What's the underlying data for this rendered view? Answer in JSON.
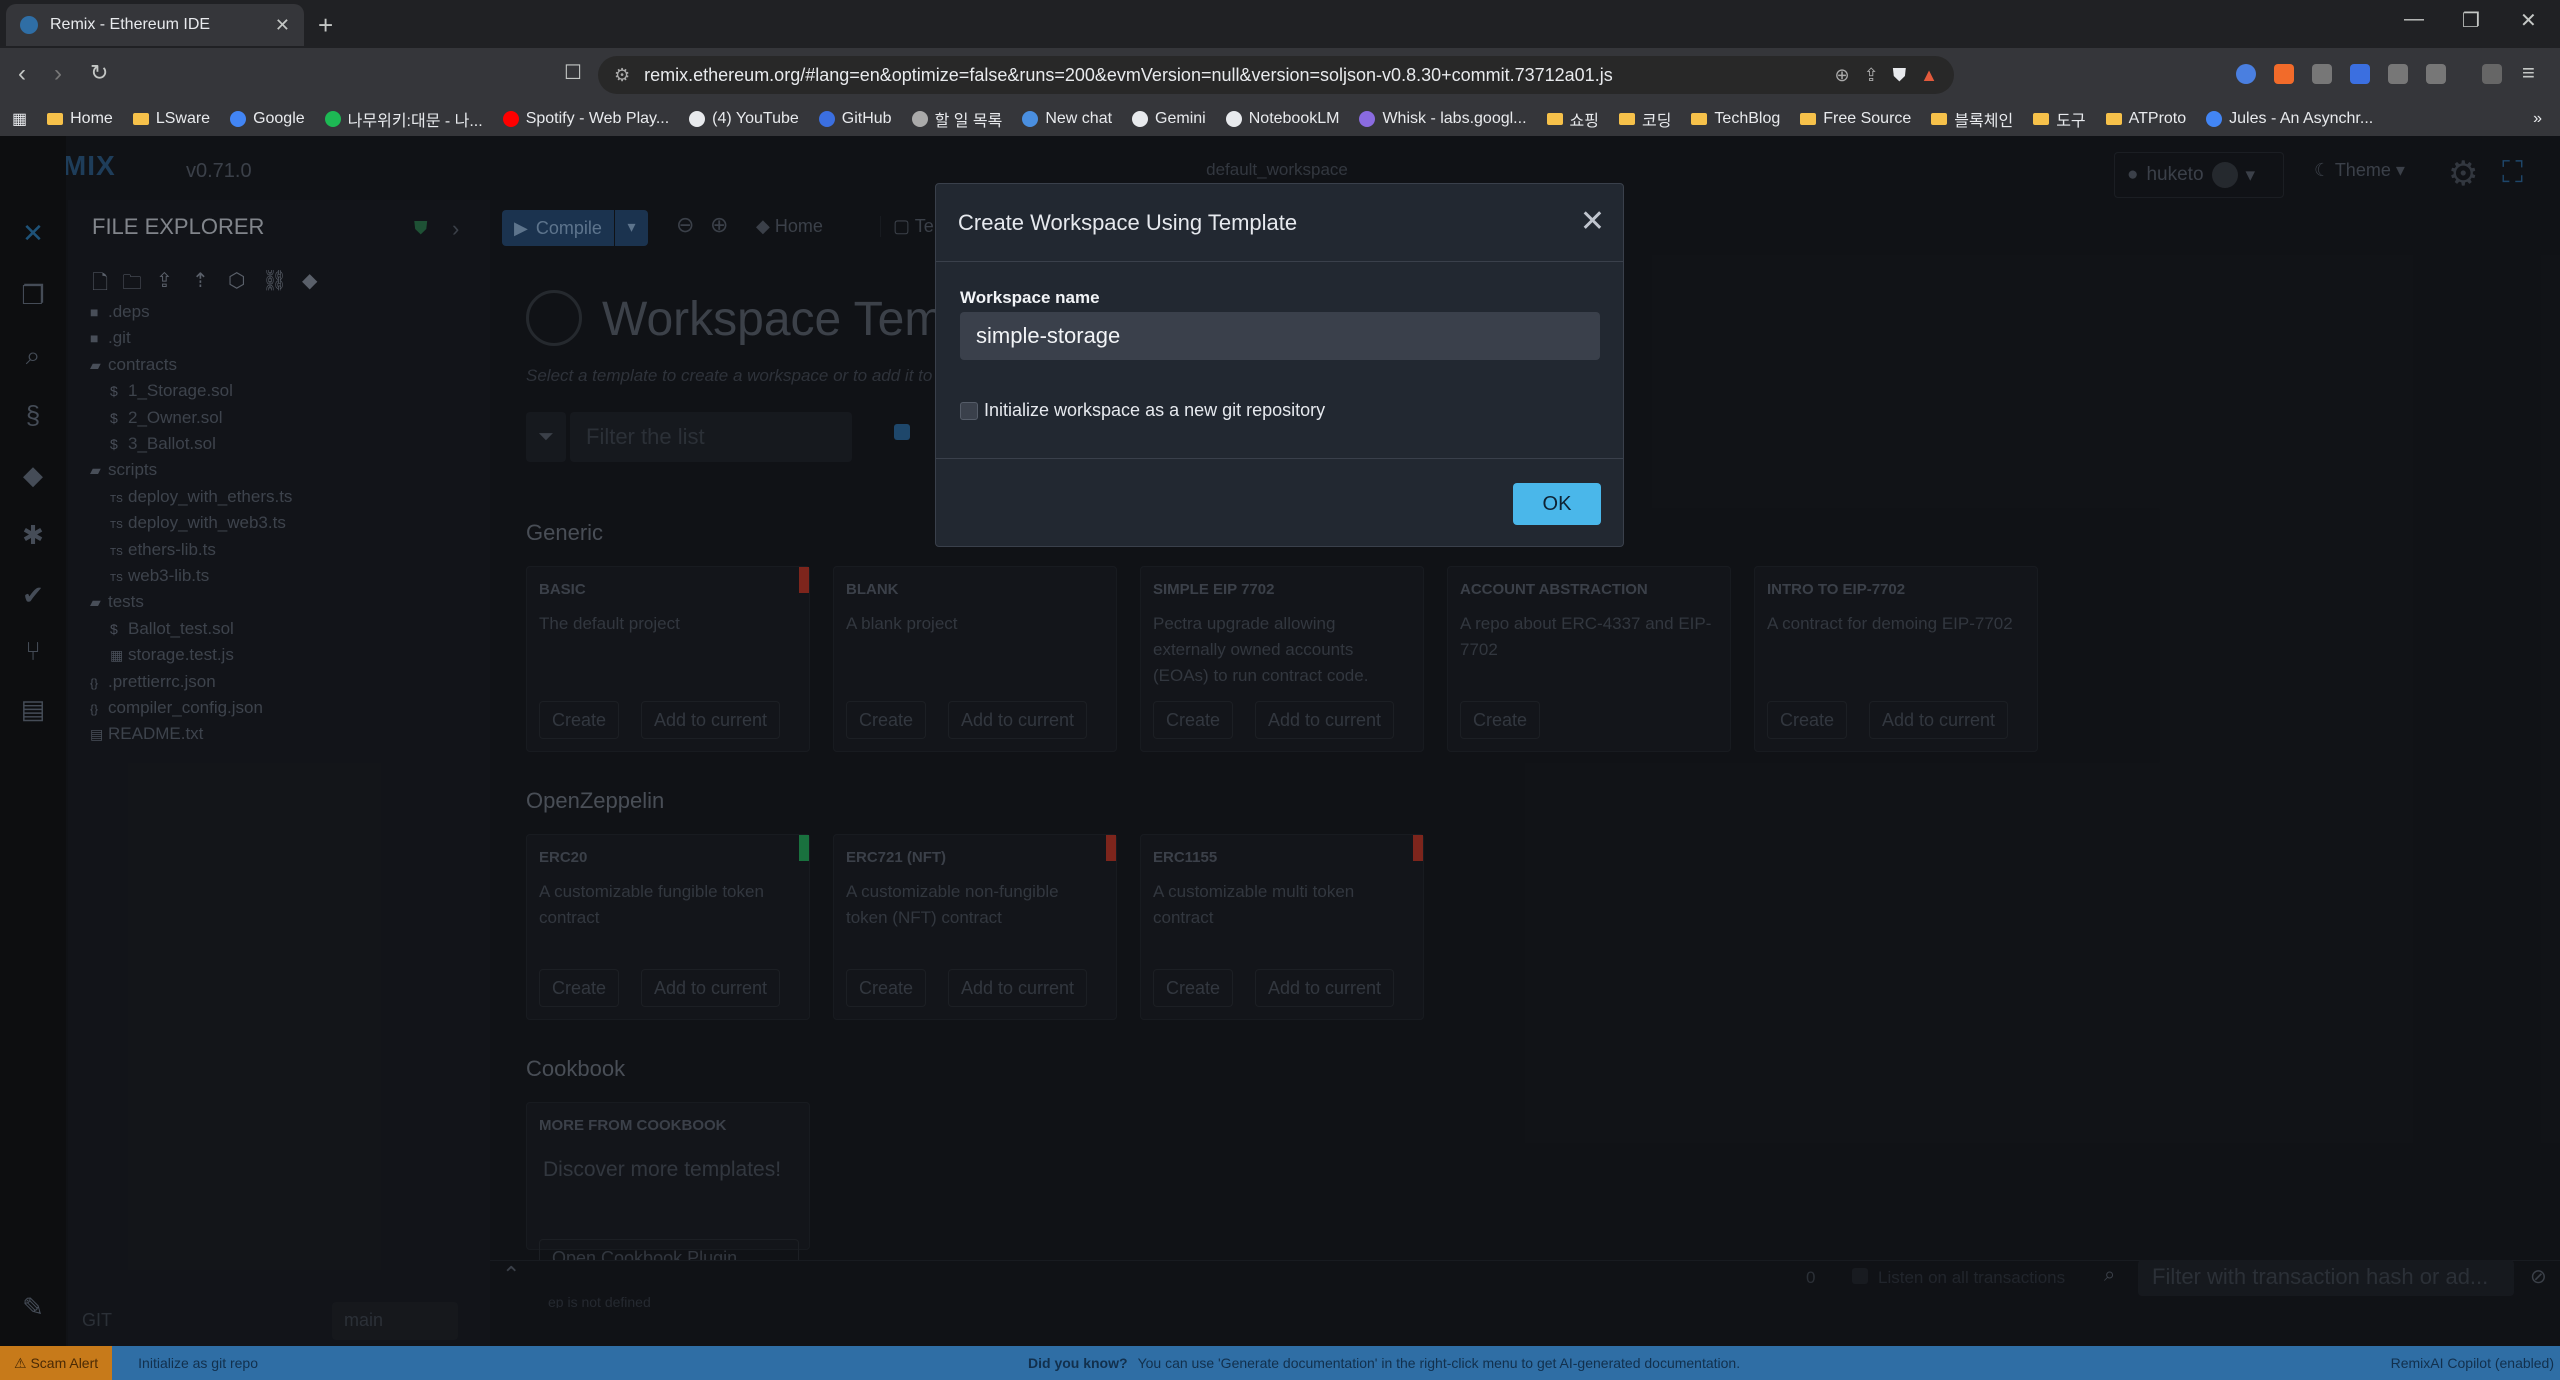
{
  "browser": {
    "tab_title": "Remix - Ethereum IDE",
    "url": "remix.ethereum.org/#lang=en&optimize=false&runs=200&evmVersion=null&version=soljson-v0.8.30+commit.73712a01.js",
    "bookmarks": [
      "Home",
      "LSware",
      "Google",
      "나무위키:대문 - 나...",
      "Spotify - Web Play...",
      "(4) YouTube",
      "GitHub",
      "할 일 목록",
      "New chat",
      "Gemini",
      "NotebookLM",
      "Whisk - labs.googl...",
      "쇼핑",
      "코딩",
      "TechBlog",
      "Free Source",
      "블록체인",
      "도구",
      "ATProto",
      "Jules - An Asynchr..."
    ]
  },
  "remix": {
    "logo": "REMIX",
    "version": "v0.71.0",
    "workspace": "default_workspace",
    "user": "huketo",
    "theme_label": "Theme",
    "file_explorer_title": "FILE EXPLORER",
    "files": [
      {
        "name": ".deps",
        "type": "folder",
        "indent": 0
      },
      {
        "name": ".git",
        "type": "folder",
        "indent": 0
      },
      {
        "name": "contracts",
        "type": "folder-open",
        "indent": 0
      },
      {
        "name": "1_Storage.sol",
        "type": "sol",
        "indent": 1
      },
      {
        "name": "2_Owner.sol",
        "type": "sol",
        "indent": 1
      },
      {
        "name": "3_Ballot.sol",
        "type": "sol",
        "indent": 1
      },
      {
        "name": "scripts",
        "type": "folder-open",
        "indent": 0
      },
      {
        "name": "deploy_with_ethers.ts",
        "type": "ts",
        "indent": 1
      },
      {
        "name": "deploy_with_web3.ts",
        "type": "ts",
        "indent": 1
      },
      {
        "name": "ethers-lib.ts",
        "type": "ts",
        "indent": 1
      },
      {
        "name": "web3-lib.ts",
        "type": "ts",
        "indent": 1
      },
      {
        "name": "tests",
        "type": "folder-open",
        "indent": 0
      },
      {
        "name": "Ballot_test.sol",
        "type": "sol",
        "indent": 1
      },
      {
        "name": "storage.test.js",
        "type": "js",
        "indent": 1
      },
      {
        "name": ".prettierrc.json",
        "type": "json",
        "indent": 0
      },
      {
        "name": "compiler_config.json",
        "type": "json",
        "indent": 0
      },
      {
        "name": "README.txt",
        "type": "txt",
        "indent": 0
      }
    ],
    "git_label": "GIT",
    "branch": "main",
    "compile_label": "Compile",
    "home_tab": "Home",
    "templates_tab": "Tem",
    "workspace_templates_title": "Workspace Temp",
    "workspace_templates_sub": "Select a template to create a workspace or to add it to",
    "filter_placeholder": "Filter the list",
    "sections": {
      "generic": "Generic",
      "openzeppelin": "OpenZeppelin",
      "cookbook": "Cookbook"
    },
    "generic_cards": [
      {
        "title": "BASIC",
        "desc": "The default project",
        "create": "Create",
        "add": "Add to current",
        "bar": "#c0392b"
      },
      {
        "title": "BLANK",
        "desc": "A blank project",
        "create": "Create",
        "add": "Add to current",
        "bar": ""
      },
      {
        "title": "SIMPLE EIP 7702",
        "desc": "Pectra upgrade allowing externally owned accounts (EOAs) to run contract code.",
        "create": "Create",
        "add": "Add to current",
        "bar": ""
      },
      {
        "title": "ACCOUNT ABSTRACTION",
        "desc": "A repo about ERC-4337 and EIP-7702",
        "create": "Create",
        "add": "",
        "bar": ""
      },
      {
        "title": "INTRO TO EIP-7702",
        "desc": "A contract for demoing EIP-7702",
        "create": "Create",
        "add": "Add to current",
        "bar": ""
      }
    ],
    "oz_cards": [
      {
        "title": "ERC20",
        "desc": "A customizable fungible token contract",
        "create": "Create",
        "add": "Add to current",
        "bar": "#27ae60"
      },
      {
        "title": "ERC721 (NFT)",
        "desc": "A customizable non-fungible token (NFT) contract",
        "create": "Create",
        "add": "Add to current",
        "bar": "#c0392b"
      },
      {
        "title": "ERC1155",
        "desc": "A customizable multi token contract",
        "create": "Create",
        "add": "Add to current",
        "bar": "#c0392b"
      }
    ],
    "cookbook_card": {
      "title": "MORE FROM COOKBOOK",
      "desc": "Discover more templates!",
      "button": "Open Cookbook Plugin"
    },
    "terminal": {
      "count": "0",
      "listen_label": "Listen on all transactions",
      "filter_placeholder": "Filter with transaction hash or ad...",
      "log": "ep is not defined"
    },
    "status": {
      "scam_alert": "Scam Alert",
      "init_git": "Initialize as git repo",
      "did_you_know": "Did you know?",
      "tip": "You can use 'Generate documentation' in the right-click menu to get AI-generated documentation.",
      "copilot": "RemixAI Copilot (enabled)"
    }
  },
  "modal": {
    "title": "Create Workspace Using Template",
    "workspace_name_label": "Workspace name",
    "workspace_name_value": "simple-storage",
    "git_init_label": "Initialize workspace as a new git repository",
    "ok_label": "OK"
  }
}
